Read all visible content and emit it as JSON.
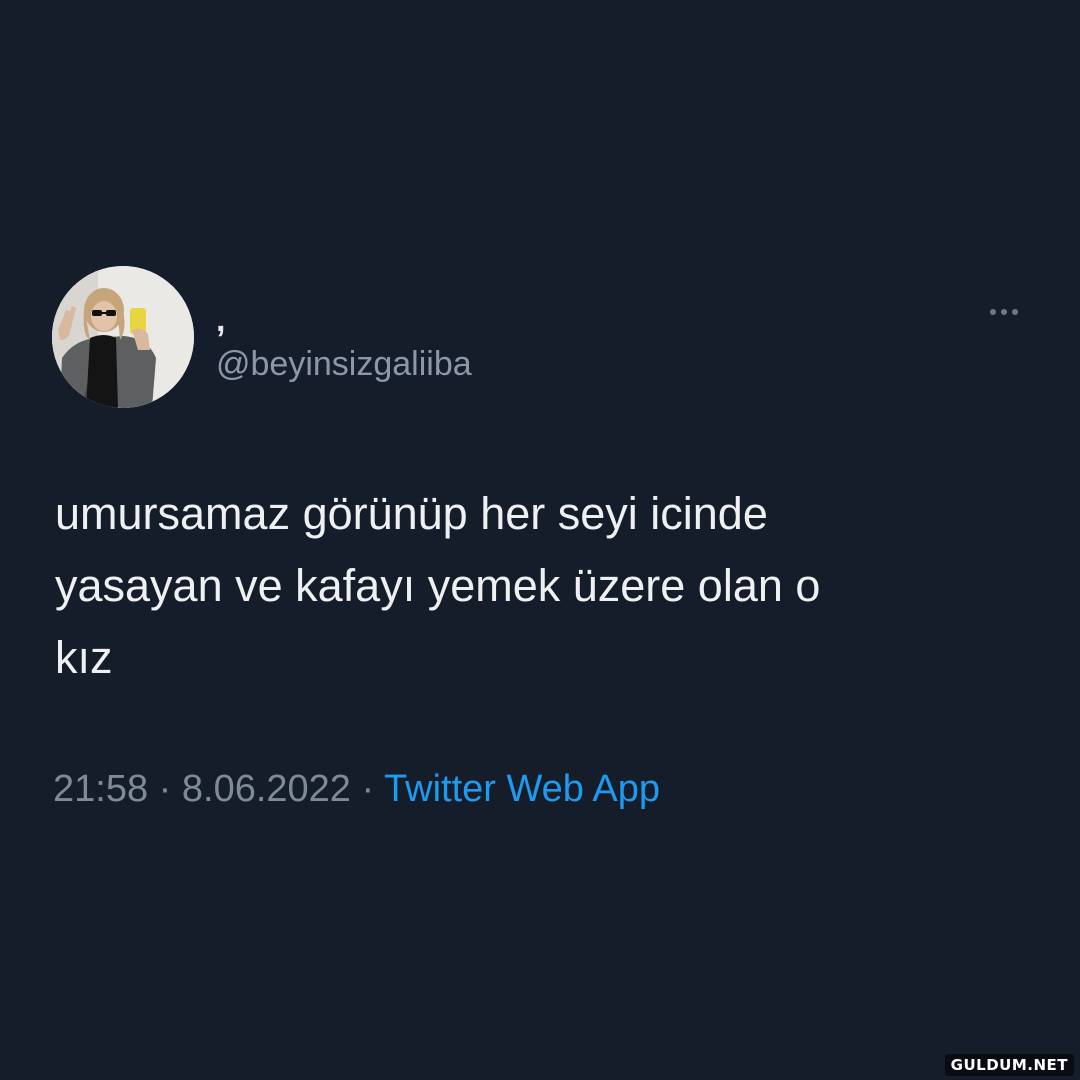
{
  "tweet": {
    "display_name": ",",
    "handle": "@beyinsizgaliiba",
    "text": "umursamaz görünüp her seyi icinde\nyasayan ve kafayı yemek üzere olan o\nkız",
    "time": "21:58",
    "separator": "·",
    "date": "8.06.2022",
    "source": "Twitter Web App",
    "more_icon": "more-horizontal-icon",
    "avatar_icon": "profile-photo"
  },
  "watermark": "GULDUM.NET",
  "colors": {
    "background": "#151d2b",
    "text": "#eef0f1",
    "secondary": "#8b98a5",
    "link": "#1d9bf0"
  }
}
